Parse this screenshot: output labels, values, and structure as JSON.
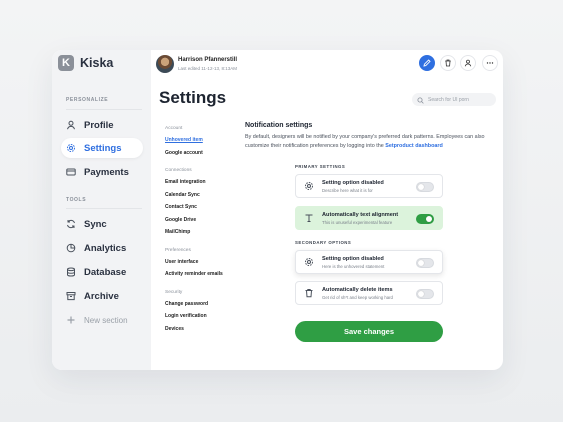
{
  "app": {
    "logo_letter": "K",
    "name": "Kiska"
  },
  "sidebar": {
    "section_personalize": "PERSONALIZE",
    "section_tools": "TOOLS",
    "items": [
      {
        "label": "Profile",
        "icon": "user-icon"
      },
      {
        "label": "Settings",
        "icon": "gear-icon",
        "active": true
      },
      {
        "label": "Payments",
        "icon": "card-icon"
      },
      {
        "label": "Sync",
        "icon": "sync-icon"
      },
      {
        "label": "Analytics",
        "icon": "pie-chart-icon"
      },
      {
        "label": "Database",
        "icon": "database-icon"
      },
      {
        "label": "Archive",
        "icon": "archive-icon"
      },
      {
        "label": "New section",
        "icon": "plus-icon"
      }
    ]
  },
  "header": {
    "user_name": "Harrison Pfannerstill",
    "last_edited": "Last edited 11-12-13, 8:13AM",
    "actions": [
      "edit-icon",
      "trash-icon",
      "user-icon",
      "more-icon"
    ]
  },
  "page": {
    "title": "Settings"
  },
  "search": {
    "placeholder": "Search for UI porn"
  },
  "subnav": {
    "groups": [
      {
        "title": "Account",
        "items": [
          "Unhovered item",
          "Google account"
        ]
      },
      {
        "title": "Connections",
        "items": [
          "Email integration",
          "Calendar Sync",
          "Contact Sync",
          "Google Drive",
          "MailChimp"
        ]
      },
      {
        "title": "Preferences",
        "items": [
          "User interface",
          "Activity reminder emails"
        ]
      },
      {
        "title": "Security",
        "items": [
          "Change password",
          "Login verification",
          "Devices"
        ]
      }
    ]
  },
  "notification": {
    "title": "Notification settings",
    "desc": "By default, designers will be notified by your company's preferred dark patterns. Employees can also customize their notification preferences by logging into the",
    "link": "Setproduct dashboard"
  },
  "primary_label": "PRIMARY SETTINGS",
  "secondary_label": "SECONDARY OPTIONS",
  "cards": [
    {
      "title": "Setting option disabled",
      "subtitle": "Describe here what it is for",
      "icon": "gear-icon",
      "on": false
    },
    {
      "title": "Automatically text alignment",
      "subtitle": "This is unuseful experimental feature",
      "icon": "text-icon",
      "on": true
    },
    {
      "title": "Setting option disabled",
      "subtitle": "Here is the unhovered statement",
      "icon": "gear-icon",
      "on": false
    },
    {
      "title": "Automatically delete items",
      "subtitle": "Get rid of sh*t and keep working hard",
      "icon": "trash-icon",
      "on": false
    }
  ],
  "save_label": "Save changes",
  "colors": {
    "accent": "#2f6fe0",
    "success": "#2f9e44",
    "success_bg": "#dcf3dc"
  }
}
